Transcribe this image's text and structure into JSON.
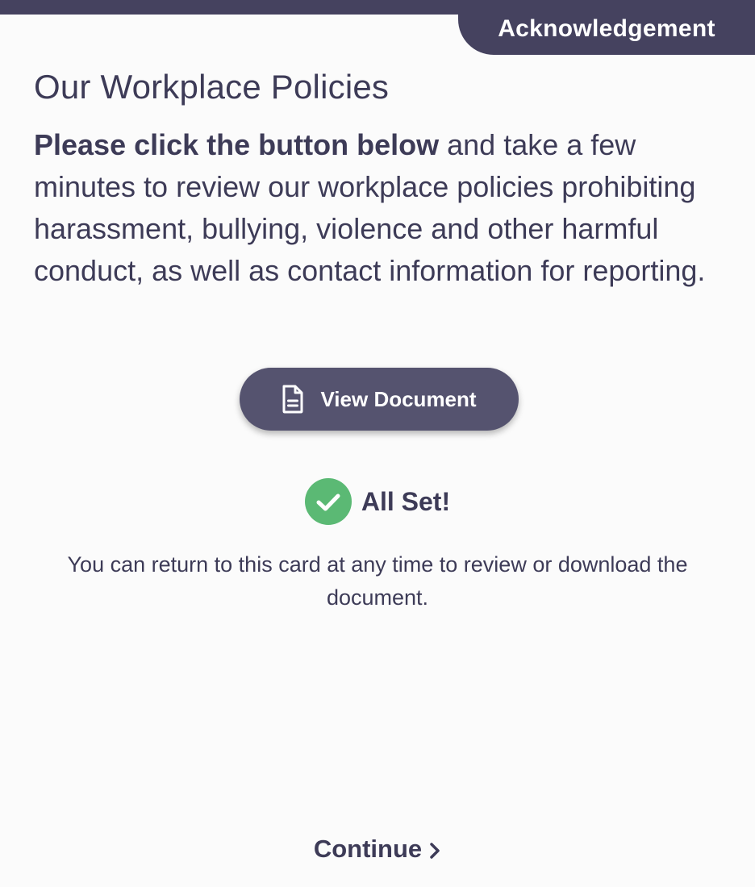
{
  "header": {
    "tag_label": "Acknowledgement"
  },
  "main": {
    "title": "Our Workplace Policies",
    "intro_bold": "Please click the button below",
    "intro_rest": " and take a few minutes to review our workplace policies prohibiting harassment, bullying, violence and other harmful conduct, as well as contact information for reporting.",
    "view_button": {
      "label": "View Document",
      "icon": "document-icon"
    },
    "status": {
      "label": "All Set!",
      "icon": "check-circle-icon"
    },
    "note": "You can return to this card at any time to review or download the document."
  },
  "footer": {
    "continue_label": "Continue",
    "continue_icon": "chevron-right-icon"
  },
  "colors": {
    "header_bg": "#45425f",
    "button_bg": "#55536f",
    "text": "#3d3b57",
    "success": "#5bb974",
    "background": "#fbfbfb"
  }
}
